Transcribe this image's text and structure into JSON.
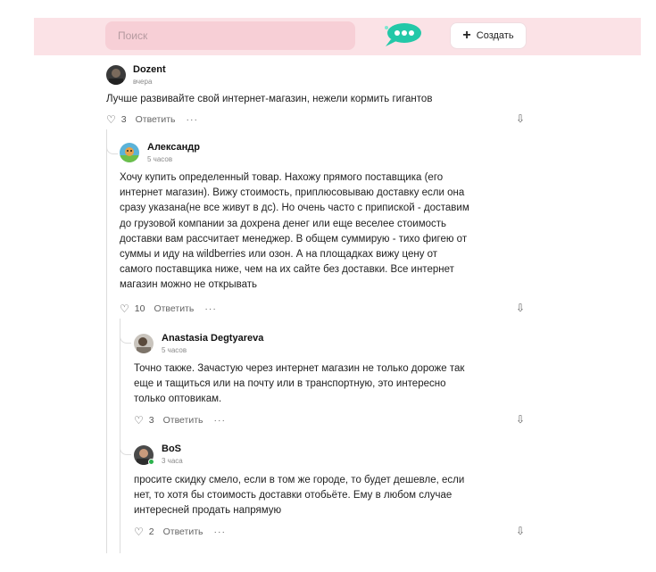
{
  "header": {
    "search_placeholder": "Поиск",
    "create_label": "Создать",
    "create_icon": "plus-icon",
    "logo_icon": "chat-bubble-icon",
    "colors": {
      "bar_bg": "#fbe2e6",
      "search_bg": "#f7cfd6",
      "logo": "#23c8a8"
    }
  },
  "comments": [
    {
      "author": "Dozent",
      "time": "вчера",
      "text": "Лучше развивайте свой интернет-магазин, нежели кормить гигантов",
      "likes": "3",
      "reply_label": "Ответить",
      "more_label": "···"
    },
    {
      "author": "Александр",
      "time": "5 часов",
      "text": "Хочу купить определенный товар. Нахожу прямого поставщика (его интернет магазин). Вижу стоимость, приплюсовываю доставку если она сразу указана(не все живут в дс). Но очень часто с припиской - доставим до грузовой компании за дохрена денег или еще веселее стоимость доставки вам рассчитает менеджер. В общем суммирую - тихо фигею от суммы и иду на wildberries или озон. А на площадках вижу цену от самого поставщика ниже, чем на их сайте без доставки. Все интернет магазин можно не открывать",
      "likes": "10",
      "reply_label": "Ответить",
      "more_label": "···"
    },
    {
      "author": "Anastasia Degtyareva",
      "time": "5 часов",
      "text": "Точно также. Зачастую через интернет магазин не только дороже так еще и тащиться или на почту или в транспортную, это интересно только оптовикам.",
      "likes": "3",
      "reply_label": "Ответить",
      "more_label": "···"
    },
    {
      "author": "BoS",
      "time": "3 часа",
      "text": "просите скидку смело, если в том же городе, то будет дешевле, если нет, то хотя бы стоимость доставки отобьёте. Ему в любом случае интересней продать напрямую",
      "likes": "2",
      "reply_label": "Ответить",
      "more_label": "···"
    }
  ]
}
